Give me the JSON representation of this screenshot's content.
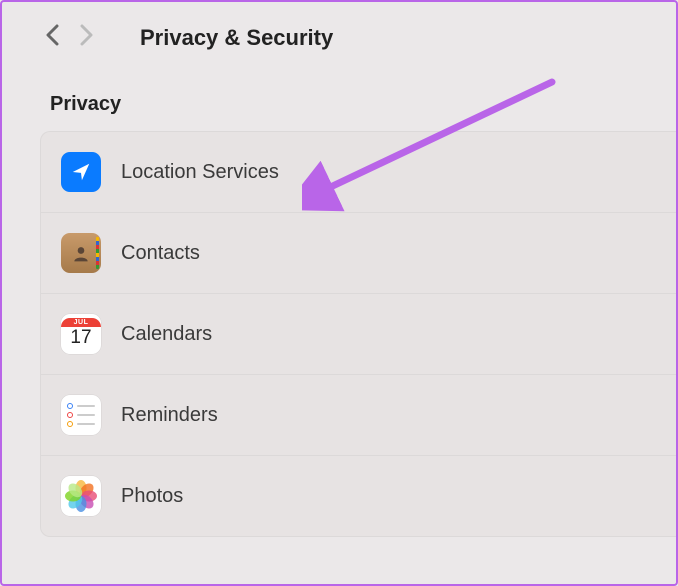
{
  "header": {
    "title": "Privacy & Security"
  },
  "section": {
    "label": "Privacy"
  },
  "items": [
    {
      "label": "Location Services"
    },
    {
      "label": "Contacts"
    },
    {
      "label": "Calendars"
    },
    {
      "label": "Reminders"
    },
    {
      "label": "Photos"
    }
  ],
  "calendar_icon": {
    "month": "JUL",
    "day": "17"
  },
  "annotation": {
    "color": "#b965e8"
  }
}
